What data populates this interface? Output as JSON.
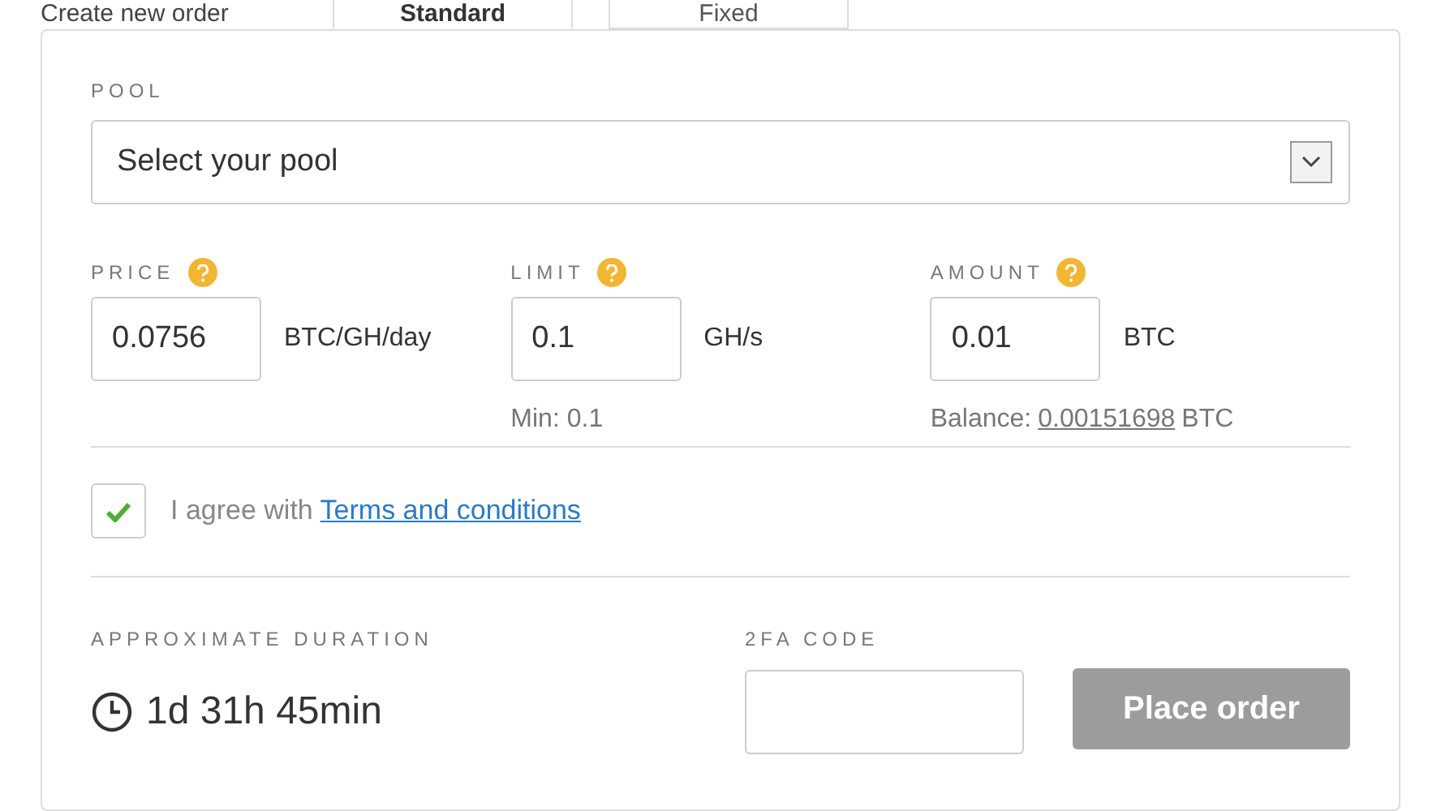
{
  "heading": "Create new order",
  "tabs": [
    {
      "label": "Standard",
      "selected": true
    },
    {
      "label": "Fixed",
      "selected": false
    }
  ],
  "pool": {
    "label": "POOL",
    "placeholder": "Select your pool"
  },
  "fields": [
    {
      "label": "PRICE",
      "value": "0.0756",
      "unit": "BTC/GH/day"
    },
    {
      "label": "LIMIT",
      "value": "0.1",
      "unit": "GH/s",
      "note": "Min: 0.1"
    },
    {
      "label": "AMOUNT",
      "value": "0.01",
      "unit": "BTC",
      "balance_label": "Balance:",
      "balance_value": "0.00151698",
      "balance_unit": "BTC"
    }
  ],
  "agree": {
    "checked": true,
    "text": "I agree with",
    "link": "Terms and conditions"
  },
  "duration": {
    "label": "APPROXIMATE DURATION",
    "value": "1d 31h 45min"
  },
  "twofa": {
    "label": "2FA CODE"
  },
  "place_order": {
    "label": "Place order",
    "disabled": true
  }
}
